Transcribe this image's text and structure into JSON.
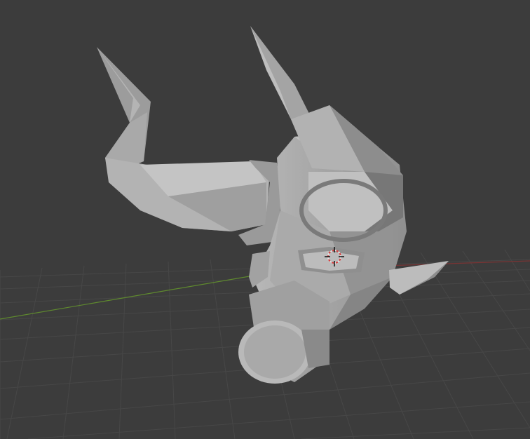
{
  "viewport": {
    "background_color": "#3c3c3c",
    "grid_color": "#4a4a4a",
    "x_axis_color": "#8a3a3a",
    "y_axis_color": "#5f8a2e"
  },
  "scene": {
    "object": "bull-head-lowpoly-mesh",
    "material_color": "#a8a8a8",
    "shadow_color": "#6e6e6e",
    "highlight_color": "#cfcfcf"
  },
  "gizmo": {
    "icon": "3d-cursor-icon",
    "ring_color_primary": "#e2e2e2",
    "ring_color_secondary": "#d94040"
  }
}
